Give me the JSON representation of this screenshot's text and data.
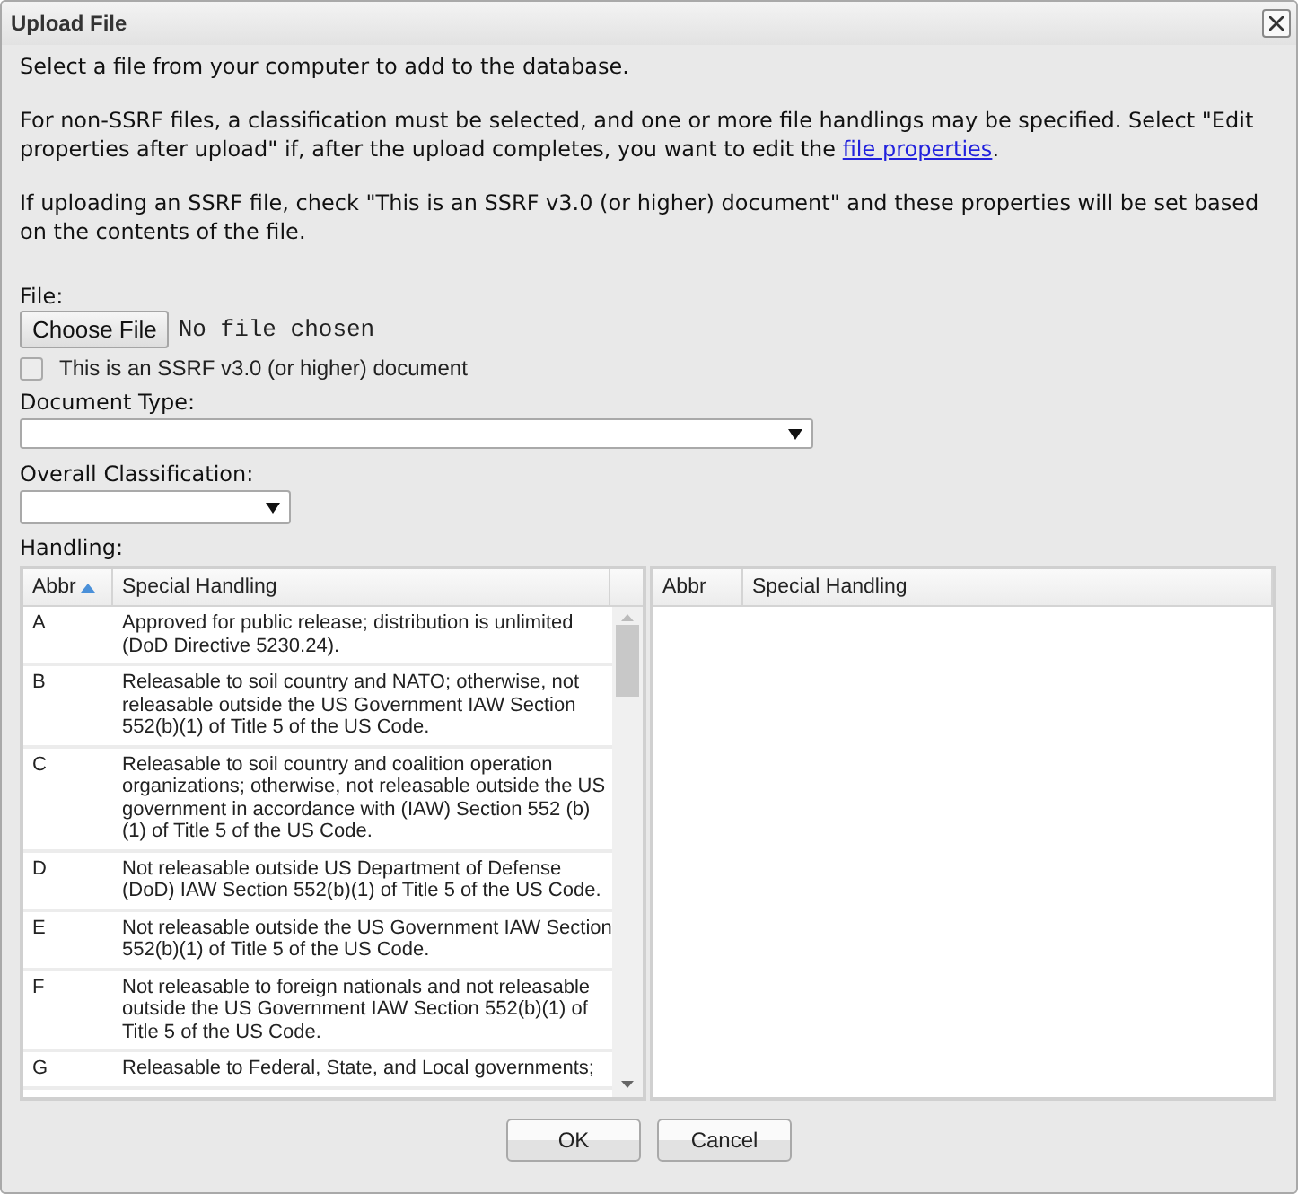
{
  "dialog": {
    "title": "Upload File"
  },
  "intro": [
    {
      "text": "Select a file from your computer to add to the database."
    },
    {
      "text": "For non-SSRF files, a classification must be selected, and one or more file handlings may be specified. Select \"Edit properties after upload\" if, after the upload completes, you want to edit the ",
      "link": "file properties",
      "after": "."
    },
    {
      "text": "If uploading an SSRF file, check \"This is an SSRF v3.0 (or higher) document\" and these properties will be set based on the contents of the file."
    }
  ],
  "file": {
    "label": "File:",
    "button": "Choose File",
    "status": "No file chosen"
  },
  "ssrf_checkbox": {
    "label": "This is an SSRF v3.0 (or higher) document",
    "checked": false
  },
  "document_type": {
    "label": "Document Type:"
  },
  "overall_classification": {
    "label": "Overall Classification:"
  },
  "handling": {
    "label": "Handling:",
    "available": {
      "columns": [
        {
          "label": "Abbr",
          "sorted": true
        },
        {
          "label": "Special Handling",
          "sorted": false
        }
      ],
      "rows": [
        {
          "abbr": "A",
          "text": "Approved for public release; distribution is unlimited (DoD Directive 5230.24)."
        },
        {
          "abbr": "B",
          "text": "Releasable to soil country and NATO; otherwise, not releasable outside the US Government IAW Section 552(b)(1) of Title 5 of the US Code."
        },
        {
          "abbr": "C",
          "text": "Releasable to soil country and coalition operation organizations; otherwise, not releasable outside the US government in accordance with (IAW) Section 552 (b)(1) of Title 5 of the US Code."
        },
        {
          "abbr": "D",
          "text": "Not releasable outside US Department of Defense (DoD) IAW Section 552(b)(1) of Title 5 of the US Code."
        },
        {
          "abbr": "E",
          "text": "Not releasable outside the US Government IAW Section 552(b)(1) of Title 5 of the US Code."
        },
        {
          "abbr": "F",
          "text": "Not releasable to foreign nationals and not releasable outside the US Government IAW Section 552(b)(1) of Title 5 of the US Code."
        },
        {
          "abbr": "G",
          "text": "Releasable to Federal, State, and Local governments;"
        }
      ]
    },
    "selected": {
      "columns": [
        {
          "label": "Abbr",
          "sorted": false
        },
        {
          "label": "Special Handling",
          "sorted": false
        }
      ]
    }
  },
  "buttons": [
    {
      "label": "OK"
    },
    {
      "label": "Cancel"
    }
  ]
}
